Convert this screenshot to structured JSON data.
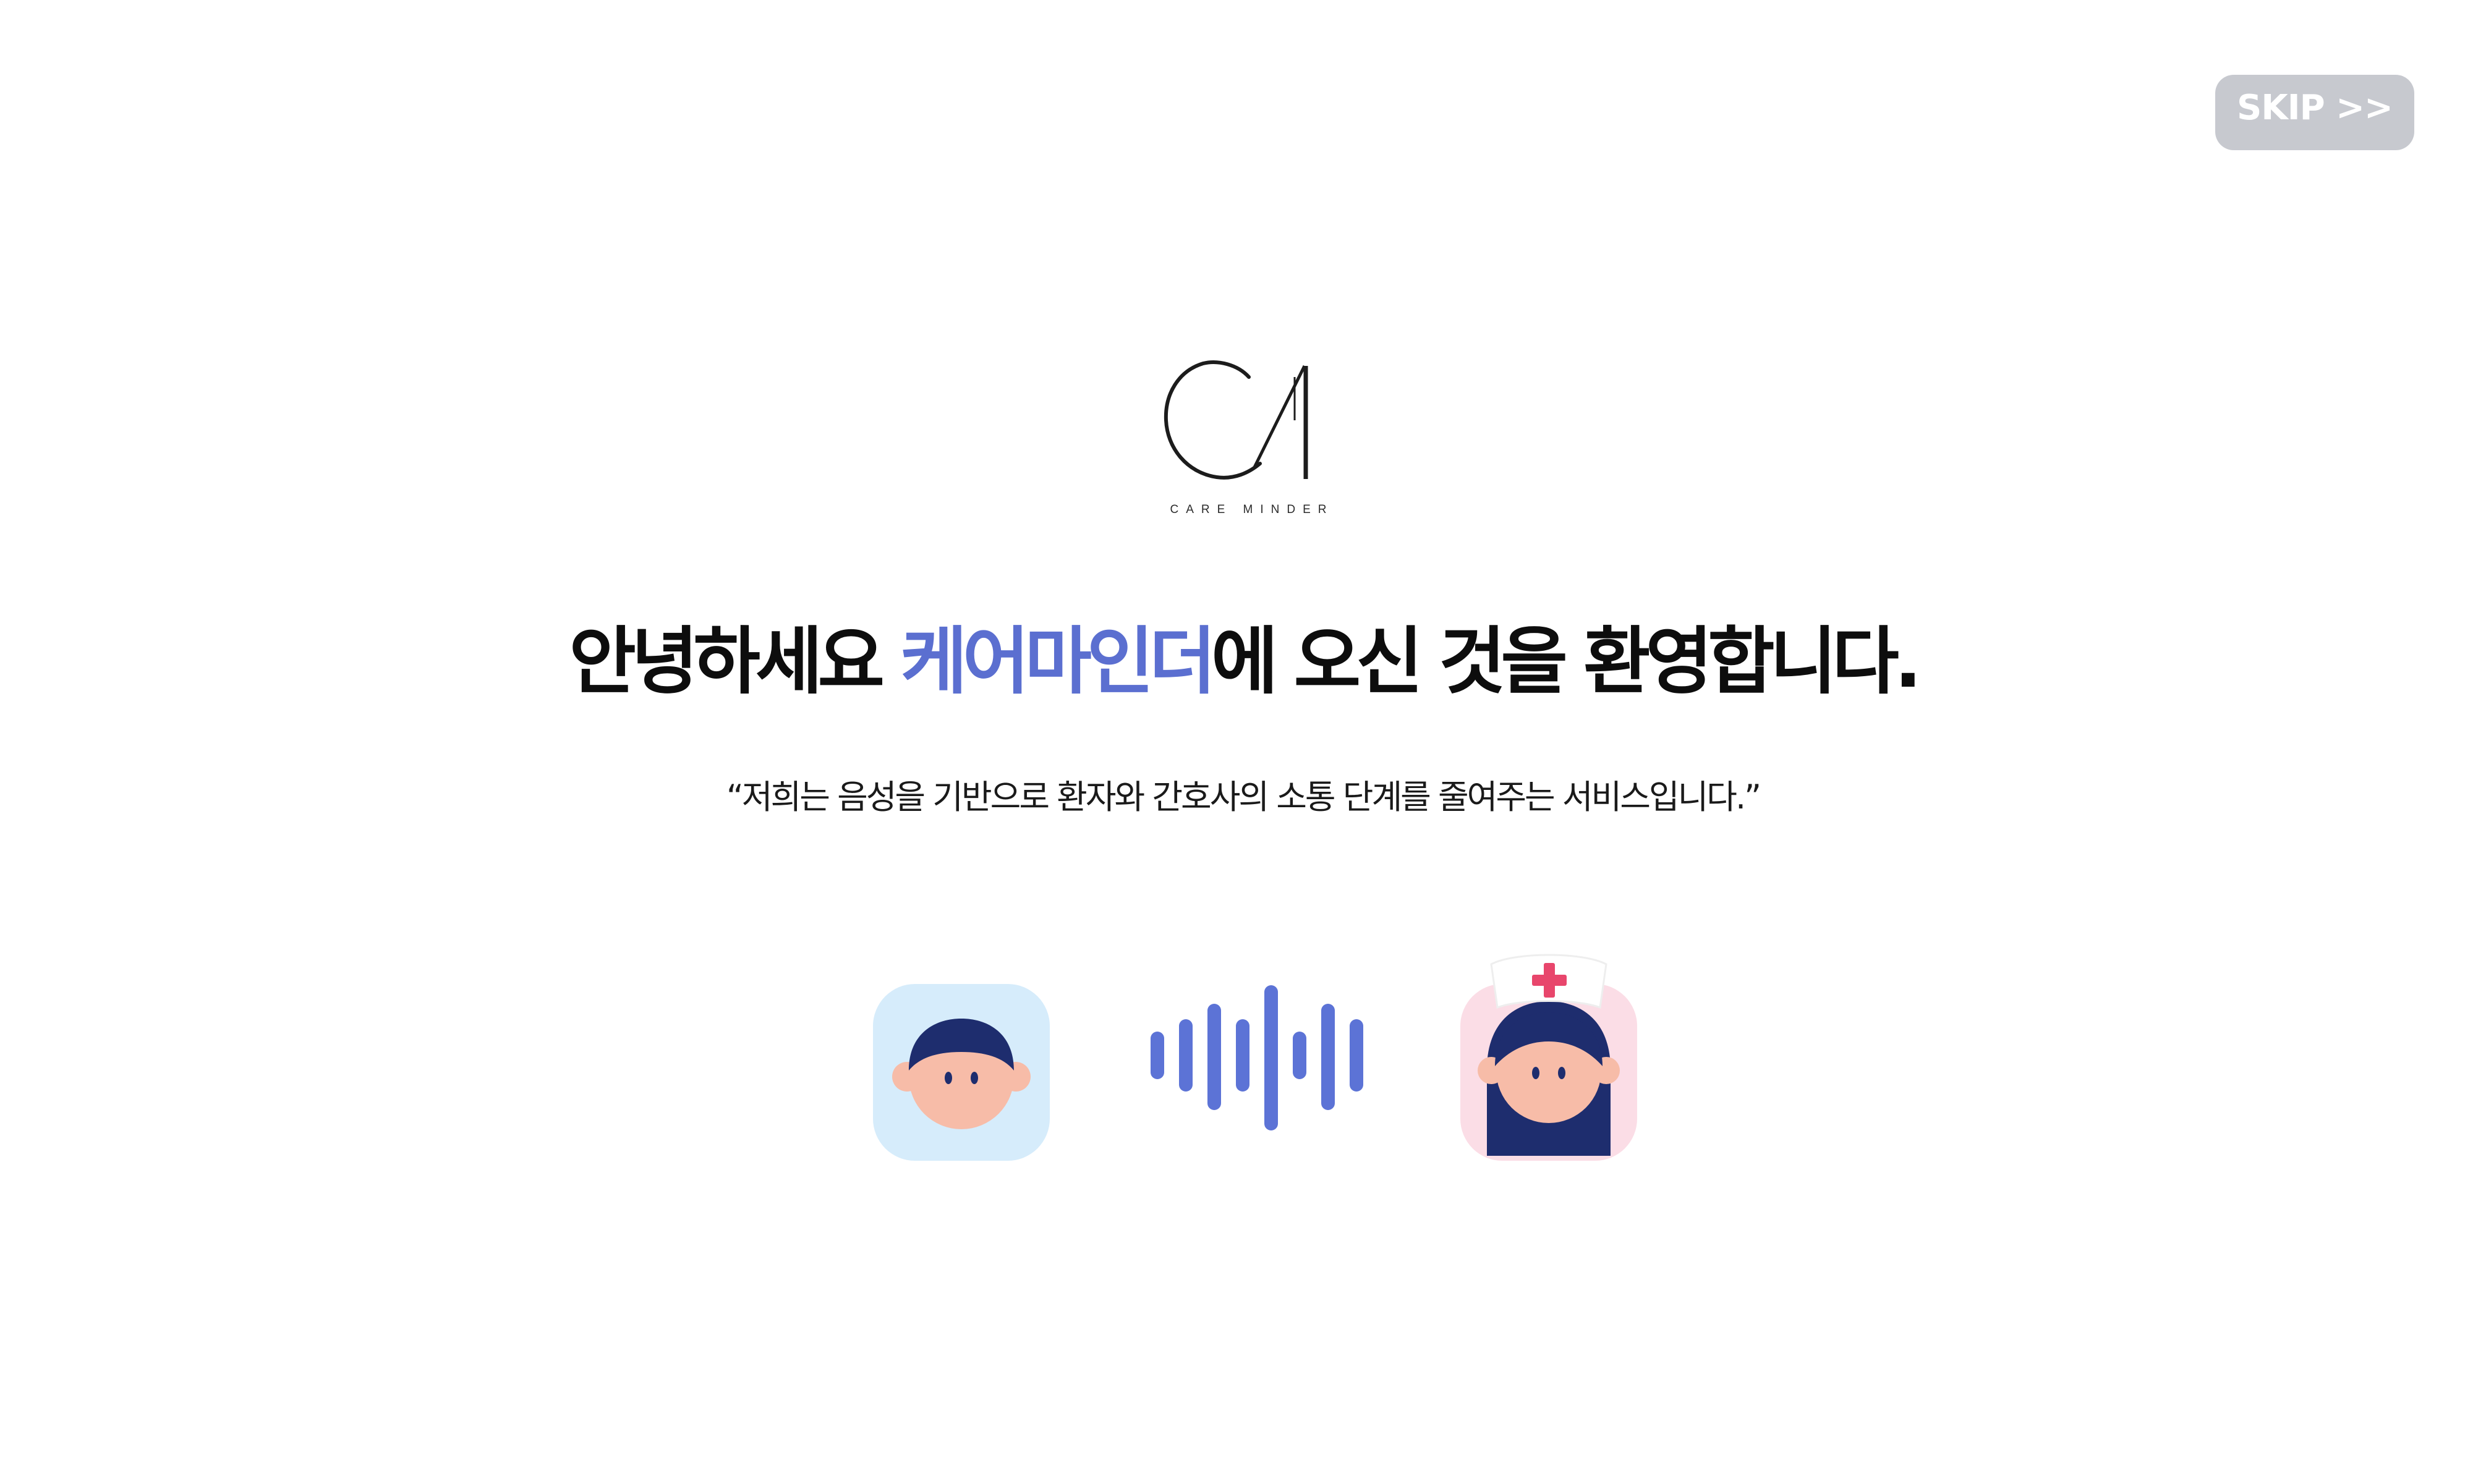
{
  "skip": {
    "label": "SKIP >>"
  },
  "logo": {
    "mark": "CM",
    "caption": "CARE MINDER"
  },
  "headline": {
    "before": "안녕하세요 ",
    "brand": "케어마인더",
    "after": "에 오신 것을 환영합니다."
  },
  "subtitle": {
    "text": "“저희는 음성을 기반으로 환자와 간호사의 소통 단계를 줄여주는 서비스입니다.”"
  },
  "colors": {
    "brand": "#5b6fd0",
    "skip_bg": "#c7c9cf",
    "patient_bg": "#d6ecfb",
    "nurse_bg": "#fbdde6",
    "hair": "#1e2d6e",
    "skin": "#f7bca8",
    "wave": "#5c73d6",
    "cross": "#e8466c"
  },
  "illustrations": {
    "left": "patient-avatar-icon",
    "center": "sound-wave-icon",
    "right": "nurse-avatar-icon"
  }
}
